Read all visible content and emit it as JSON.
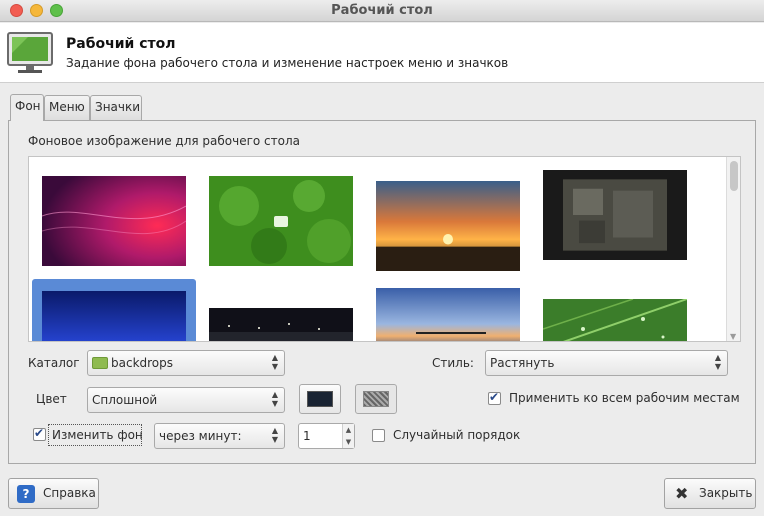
{
  "window": {
    "title": "Рабочий стол"
  },
  "header": {
    "title": "Рабочий стол",
    "subtitle": "Задание фона рабочего стола и изменение настроек меню и значков",
    "icon": "desktop-monitor-icon"
  },
  "tabs": [
    {
      "label": "Фон",
      "active": true
    },
    {
      "label": "Меню",
      "active": false
    },
    {
      "label": "Значки",
      "active": false
    }
  ],
  "panel": {
    "label": "Фоновое изображение для рабочего стола"
  },
  "gallery": {
    "thumbnails": [
      {
        "name": "purple-red-abstract",
        "selected": false
      },
      {
        "name": "green-bokeh-mint",
        "selected": false
      },
      {
        "name": "sunset-clouds",
        "selected": false
      },
      {
        "name": "stone-carvings",
        "selected": false
      },
      {
        "name": "blue-gradient",
        "selected": true
      },
      {
        "name": "night-city",
        "selected": false
      },
      {
        "name": "pier-twilight",
        "selected": false
      },
      {
        "name": "green-leaf-drops",
        "selected": false
      }
    ]
  },
  "controls": {
    "catalog_label": "Каталог",
    "catalog_value": "backdrops",
    "style_label": "Стиль:",
    "style_value": "Растянуть",
    "color_label": "Цвет",
    "color_value": "Сплошной",
    "primary_color": "#1a2433",
    "apply_all_label": "Применить ко всем рабочим местам",
    "apply_all_checked": true,
    "change_bg_label": "Изменить фон",
    "change_bg_checked": true,
    "interval_value": "через минут:",
    "interval_number": "1",
    "random_label": "Случайный порядок",
    "random_checked": false
  },
  "footer": {
    "help_label": "Справка",
    "close_label": "Закрыть"
  }
}
